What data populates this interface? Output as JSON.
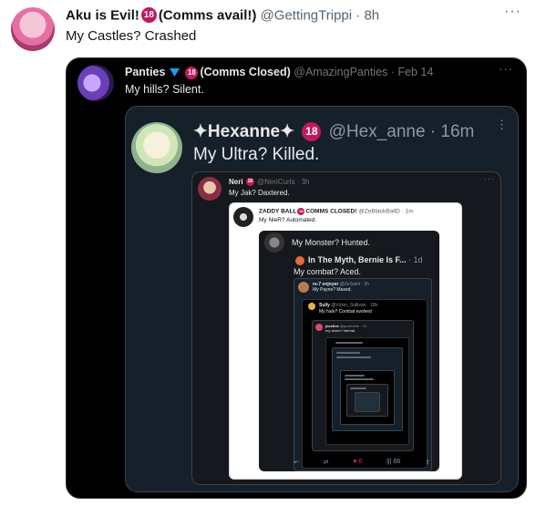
{
  "tweet": {
    "name": "Aku is Evil!",
    "age_badge": "18",
    "name_suffix": "(Comms avail!)",
    "handle": "@GettingTrippi",
    "time": "· 8h",
    "text": "My Castles? Crashed",
    "more": "···"
  },
  "quote1": {
    "name": "Panties",
    "age_badge": "18",
    "name_suffix": "(Comms Closed)",
    "handle": "@AmazingPanties · Feb 14",
    "text": "My hills? Silent.",
    "more": "···"
  },
  "quote2": {
    "name": "✦Hexanne✦",
    "age_badge": "18",
    "handle": "@Hex_anne · 16m",
    "text": "My Ultra? Killed.",
    "more": "⋮"
  },
  "quote3": {
    "name": "Neri",
    "age_badge": "18",
    "handle": "@NeriCurls · 3h",
    "text": "My Jak? Daxtered.",
    "more": "···"
  },
  "quote4": {
    "name": "ZADDY BALL",
    "age_badge": "18",
    "name_suffix": "COMMS CLOSED!",
    "handle": "@ZeBlackBallD · 1m",
    "text": "My NieR? Automated."
  },
  "quote5": {
    "text": "My Monster? Hunted.",
    "bernie_name": "In The Myth, Bernie Is F...",
    "bernie_time": "· 1d",
    "bernie_text": "My combat? Aced."
  },
  "quote6": {
    "name": "re-7 enjoyer",
    "handle": "@ZeSaint · 2h",
    "text": "My Payne? Maxed."
  },
  "quote7": {
    "name": "Sully",
    "handle": "@Victor_Sullivan · 10h",
    "text": "My halo? Combat evolved"
  },
  "quote8": {
    "name": "joceline",
    "handle": "@joceinetie · 1h",
    "text": "my doom? eternal."
  },
  "actions": {
    "reply": "↩",
    "retweet": "⇄",
    "like": "♥",
    "views": "|||",
    "share": "⇪",
    "like_count": "6",
    "view_count": "66"
  },
  "colors": {
    "age_badge": "#c2185b",
    "verified": "#1d9bf0",
    "like": "#f91880"
  },
  "icons": [
    "more-icon",
    "verified-badge-icon",
    "age-18-icon",
    "reply-icon",
    "retweet-icon",
    "like-icon",
    "views-icon",
    "share-icon"
  ]
}
